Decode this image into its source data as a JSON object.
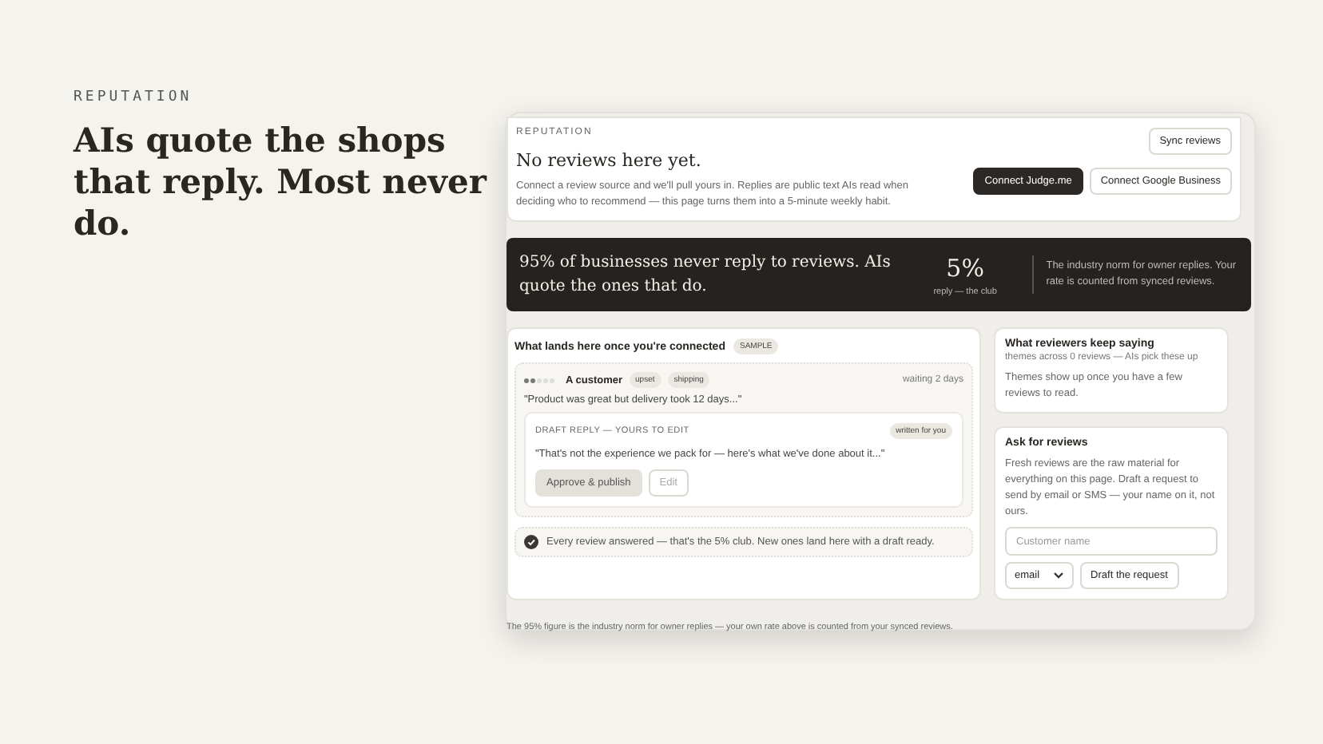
{
  "hero": {
    "eyebrow": "REPUTATION",
    "headline": "AIs quote the shops that reply. Most never do."
  },
  "header": {
    "eyebrow": "REPUTATION",
    "title": "No reviews here yet.",
    "description": "Connect a review source and we'll pull yours in. Replies are public text AIs read when deciding who to recommend — this page turns them into a 5-minute weekly habit.",
    "sync_button": "Sync reviews",
    "connect_buttons": [
      {
        "label": "Connect Judge.me",
        "kind": "primary"
      },
      {
        "label": "Connect Google Business",
        "kind": "secondary"
      }
    ]
  },
  "banner": {
    "statement": "95% of businesses never reply to reviews. AIs quote the ones that do.",
    "stat": "5%",
    "stat_caption": "reply — the club",
    "note": "The industry norm for owner replies. Your rate is counted from synced reviews."
  },
  "preview": {
    "title": "What lands here once you're connected",
    "badge": "SAMPLE",
    "review": {
      "stars": 2,
      "author": "A customer",
      "tags": [
        "upset",
        "shipping"
      ],
      "age": "waiting 2 days",
      "quote": "\"Product was great but delivery took 12 days...\"",
      "draft": {
        "label": "DRAFT REPLY — YOURS TO EDIT",
        "badge": "written for you",
        "text": "\"That's not the experience we pack for — here's what we've done about it...\"",
        "approve_button": "Approve & publish",
        "edit_button": "Edit"
      }
    },
    "footer": "Every review answered — that's the 5% club. New ones land here with a draft ready."
  },
  "themes": {
    "title": "What reviewers keep saying",
    "subtitle": "themes across 0 reviews — AIs pick these up",
    "empty": "Themes show up once you have a few reviews to read."
  },
  "ask": {
    "title": "Ask for reviews",
    "description": "Fresh reviews are the raw material for everything on this page. Draft a request to send by email or SMS — your name on it, not ours.",
    "name_field": {
      "placeholder": "Customer name"
    },
    "channel": "email",
    "draft_button": "Draft the request"
  },
  "footnote": "The 95% figure is the industry norm for owner replies — your own rate above is counted from your synced reviews."
}
